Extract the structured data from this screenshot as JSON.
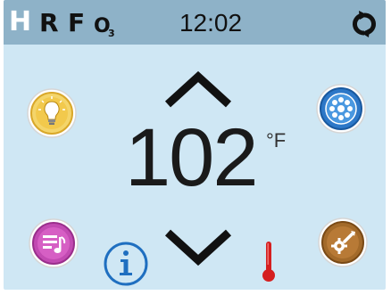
{
  "status_bar": {
    "indicators": [
      "H",
      "R",
      "F",
      "O",
      "3"
    ],
    "time": "12:02",
    "cycle_icon": "refresh-cycle-icon"
  },
  "setpoint": {
    "temperature": "102",
    "unit": "°F"
  },
  "buttons": {
    "light": "light-bulb-icon",
    "jets": "jets-icon",
    "audio": "audio-icon",
    "settings": "settings-icon",
    "info": "info-icon"
  },
  "colors": {
    "screen_bg": "#cfe7f4",
    "status_bar_bg": "#8eb2c8",
    "thermometer": "#d51f1f"
  }
}
